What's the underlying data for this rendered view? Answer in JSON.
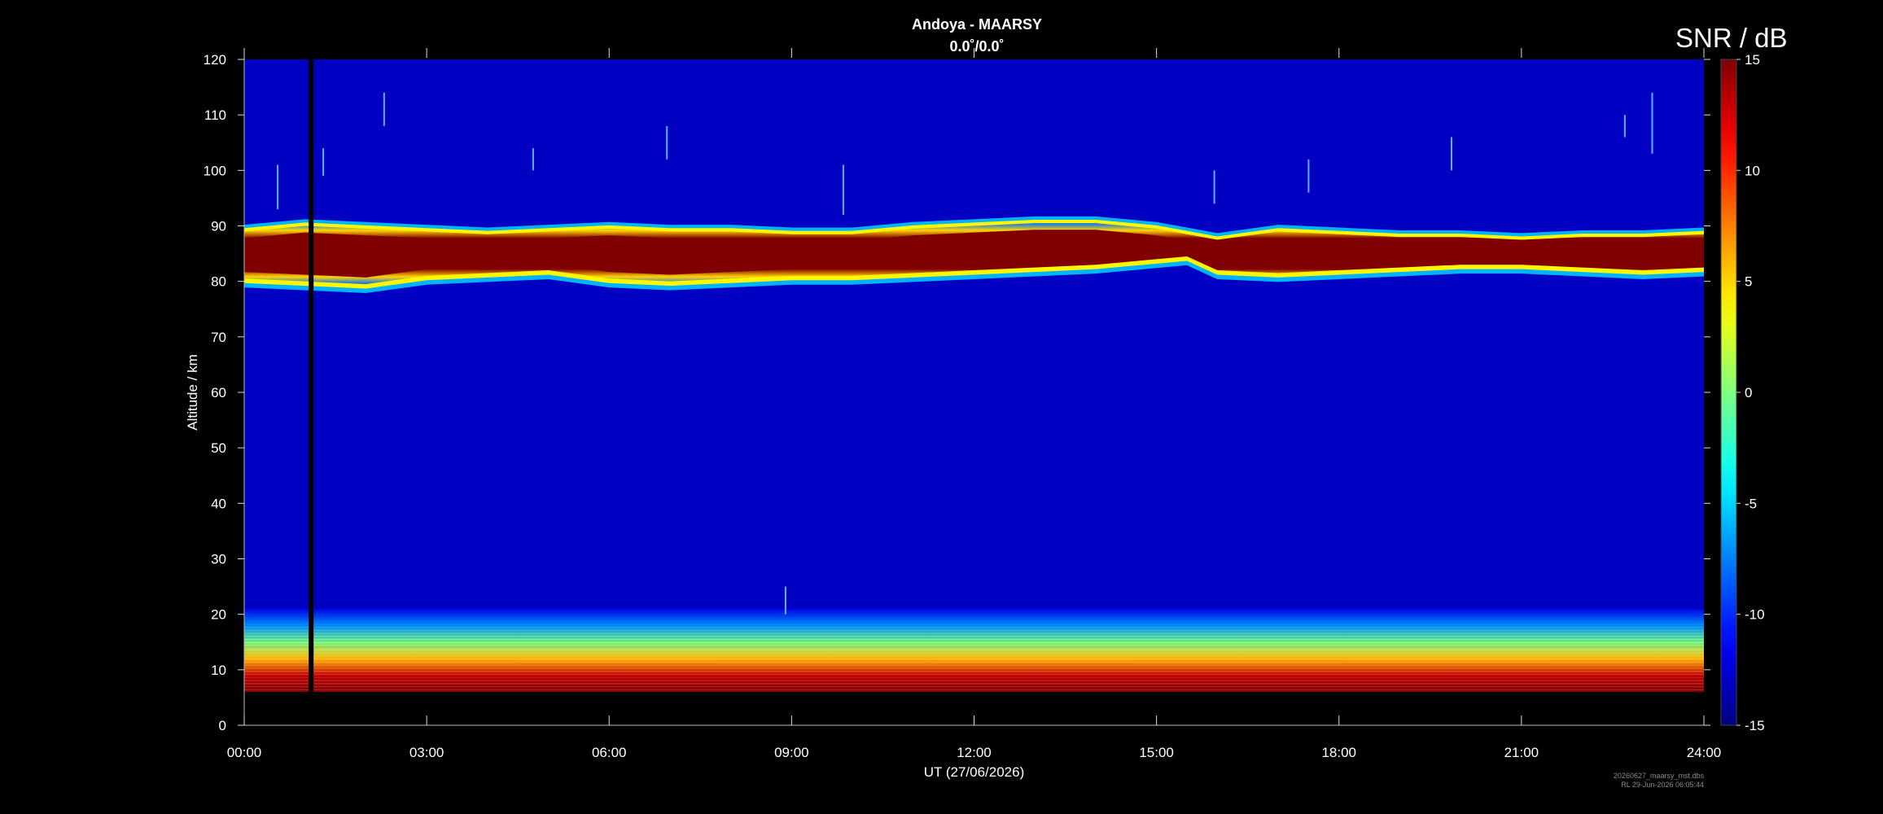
{
  "figure": {
    "title": "Andoya - MAARSY",
    "subtitle": "0.0˚/0.0˚",
    "colorbar_label": "SNR / dB",
    "footer_line1": "20260627_maarsy_mst.dbs",
    "footer_line2": "RL 29-Jun-2026 06:05:44"
  },
  "chart_data": {
    "type": "heatmap",
    "title": "Andoya - MAARSY",
    "subtitle": "0.0˚/0.0˚",
    "xlabel": "UT (27/06/2026)",
    "ylabel": "Altitude / km",
    "xlim": [
      0,
      24
    ],
    "ylim": [
      0,
      120
    ],
    "x_ticks": [
      0,
      3,
      6,
      9,
      12,
      15,
      18,
      21,
      24
    ],
    "x_tick_labels": [
      "00:00",
      "03:00",
      "06:00",
      "09:00",
      "12:00",
      "15:00",
      "18:00",
      "21:00",
      "24:00"
    ],
    "y_ticks": [
      0,
      10,
      20,
      30,
      40,
      50,
      60,
      70,
      80,
      90,
      100,
      110,
      120
    ],
    "y_tick_labels": [
      "0",
      "10",
      "20",
      "30",
      "40",
      "50",
      "60",
      "70",
      "80",
      "90",
      "100",
      "110",
      "120"
    ],
    "colorbar": {
      "label": "SNR / dB",
      "range": [
        -15,
        15
      ],
      "ticks": [
        -15,
        -10,
        -5,
        0,
        5,
        10,
        15
      ],
      "tick_labels": [
        "-15",
        "-10",
        "-5",
        "0",
        "5",
        "10",
        "15"
      ],
      "colormap": "jet"
    },
    "background_snr_db": -13,
    "data_gap_ut": 1.1,
    "data_gap_colour": "#000000",
    "blank_below_altitude_km": 6,
    "pmse_layer": {
      "description": "Polar mesosphere summer echo layer",
      "time_ut": [
        0,
        1,
        2,
        3,
        4,
        5,
        6,
        7,
        8,
        9,
        10,
        11,
        12,
        13,
        14,
        15,
        15.5,
        16,
        17,
        18,
        19,
        20,
        21,
        22,
        23,
        24
      ],
      "bottom_km": [
        80.5,
        80,
        79.5,
        81,
        81.5,
        82,
        80.5,
        80,
        80.5,
        81,
        81,
        81.5,
        82,
        82.5,
        83,
        84,
        84.5,
        82,
        81.5,
        82,
        82.5,
        83,
        83,
        82.5,
        82,
        82.5
      ],
      "top_km": [
        89,
        90,
        89.5,
        89,
        88.5,
        89,
        89.5,
        89,
        89,
        88.5,
        88.5,
        89.5,
        90,
        90.5,
        90.5,
        89.5,
        88.5,
        87.5,
        89,
        88.5,
        88,
        88,
        87.5,
        88,
        88,
        88.5
      ],
      "peak_snr_db": 15
    },
    "tropo_echo": {
      "description": "Troposphere / lower stratosphere echoes",
      "bottom_km": 6,
      "top_km": 21,
      "snr_db_at_altitude": [
        [
          6,
          15
        ],
        [
          9,
          13
        ],
        [
          12,
          6
        ],
        [
          15,
          0
        ],
        [
          18,
          -7
        ],
        [
          21,
          -12
        ]
      ]
    },
    "meteor_streaks": [
      {
        "ut": 0.55,
        "alt_km": [
          93,
          101
        ]
      },
      {
        "ut": 1.3,
        "alt_km": [
          99,
          104
        ]
      },
      {
        "ut": 2.3,
        "alt_km": [
          108,
          114
        ]
      },
      {
        "ut": 4.75,
        "alt_km": [
          100,
          104
        ]
      },
      {
        "ut": 6.95,
        "alt_km": [
          102,
          108
        ]
      },
      {
        "ut": 8.9,
        "alt_km": [
          20,
          25
        ]
      },
      {
        "ut": 9.85,
        "alt_km": [
          92,
          101
        ]
      },
      {
        "ut": 15.95,
        "alt_km": [
          94,
          100
        ]
      },
      {
        "ut": 17.5,
        "alt_km": [
          96,
          102
        ]
      },
      {
        "ut": 19.85,
        "alt_km": [
          100,
          106
        ]
      },
      {
        "ut": 22.7,
        "alt_km": [
          106,
          110
        ]
      },
      {
        "ut": 23.15,
        "alt_km": [
          103,
          114
        ]
      }
    ]
  }
}
